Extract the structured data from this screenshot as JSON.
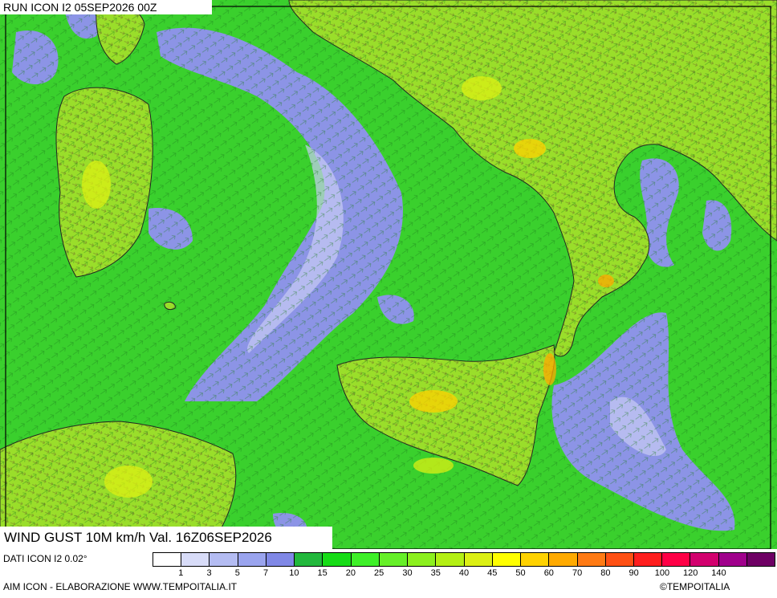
{
  "header": {
    "run_title": "RUN ICON I2 05SEP2026 00Z"
  },
  "map": {
    "variable_title": "WIND GUST 10M km/h Val. 16Z06SEP2026",
    "sea_color": "#2ec92e",
    "calm_color": "#8c94e6",
    "land_color": "#9ade2a"
  },
  "footer": {
    "data_source": "DATI ICON I2 0.02°",
    "credits": "AIM ICON - ELABORAZIONE WWW.TEMPOITALIA.IT",
    "copyright": "©TEMPOITALIA"
  },
  "legend": {
    "colors": [
      "#ffffff",
      "#d8dcf8",
      "#b4bcf2",
      "#9aa4ee",
      "#8088e6",
      "#22b83c",
      "#16dc16",
      "#3ef028",
      "#66f028",
      "#8cf01e",
      "#b4f014",
      "#dcf014",
      "#ffff00",
      "#ffd200",
      "#ffaa00",
      "#ff7a14",
      "#ff5014",
      "#ff1e1e",
      "#ff0046",
      "#d2006e",
      "#a0008c",
      "#6e0064"
    ],
    "labels": [
      "1",
      "3",
      "5",
      "7",
      "10",
      "15",
      "20",
      "25",
      "30",
      "35",
      "40",
      "45",
      "50",
      "60",
      "70",
      "80",
      "90",
      "100",
      "120",
      "140"
    ]
  }
}
